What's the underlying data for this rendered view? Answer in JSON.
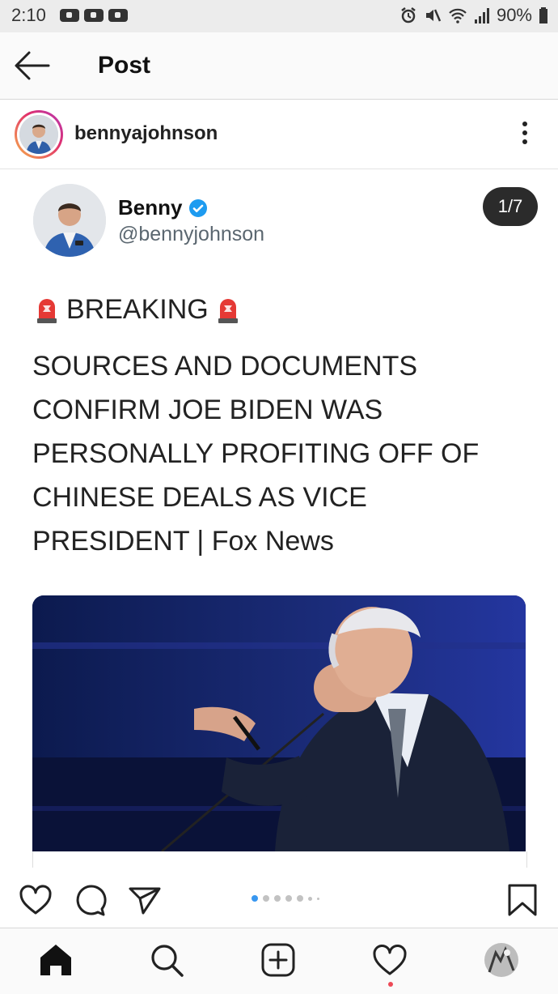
{
  "status_bar": {
    "time": "2:10",
    "battery": "90%",
    "icons": [
      "youtube-icon",
      "youtube-icon",
      "youtube-icon",
      "alarm-icon",
      "mute-icon",
      "wifi-icon",
      "signal-icon",
      "battery-icon"
    ]
  },
  "header": {
    "title": "Post",
    "back_icon": "arrow-left-icon"
  },
  "post": {
    "username": "bennyajohnson",
    "more_icon": "more-vertical-icon"
  },
  "card": {
    "name": "Benny",
    "handle": "@bennyjohnson",
    "verified_icon": "verified-badge-icon",
    "counter": "1/7",
    "breaking": "BREAKING",
    "headline": "SOURCES AND DOCUMENTS CONFIRM JOE BIDEN WAS PERSONALLY PROFITING OFF OF CHINESE DEALS AS VICE PRESIDENT  | Fox News",
    "siren_icon": "police-light-emoji"
  },
  "actions": {
    "icons": [
      "heart-icon",
      "comment-icon",
      "share-icon",
      "bookmark-icon"
    ],
    "carousel": {
      "total": 7,
      "active": 1
    }
  },
  "bottom_nav": {
    "icons": [
      "home-icon",
      "search-icon",
      "add-post-icon",
      "activity-heart-icon",
      "profile-avatar"
    ]
  },
  "colors": {
    "accent": "#3897f0",
    "verified": "#1d9bf0",
    "notification": "#ed4956",
    "counter_bg": "#2b2b2b"
  }
}
